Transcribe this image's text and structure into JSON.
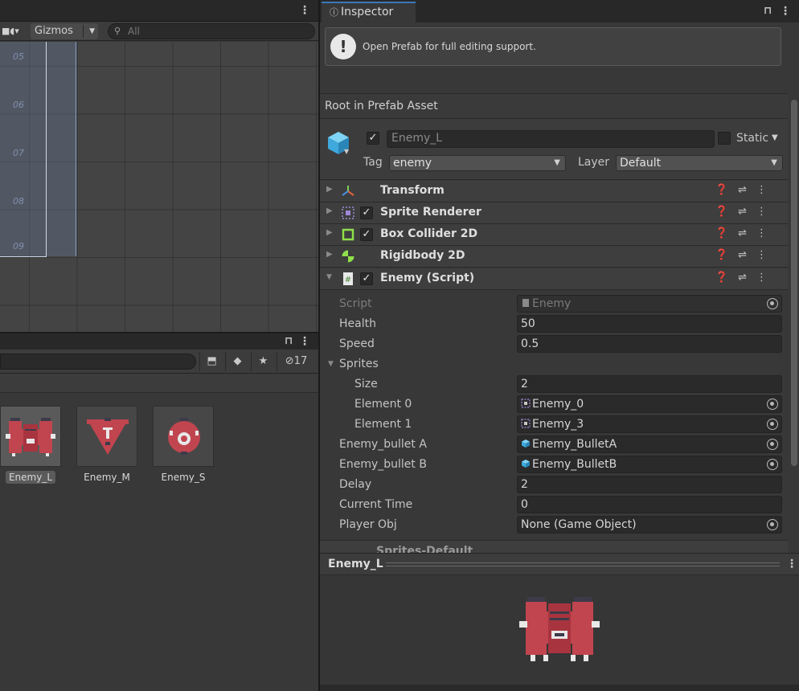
{
  "scene": {
    "gizmos_label": "Gizmos",
    "search_placeholder": "All",
    "row_labels": [
      "05",
      "06",
      "07",
      "08",
      "09"
    ]
  },
  "project": {
    "hidden_count": "17",
    "assets": [
      {
        "name": "Enemy_L",
        "selected": true
      },
      {
        "name": "Enemy_M",
        "selected": false
      },
      {
        "name": "Enemy_S",
        "selected": false
      }
    ]
  },
  "inspector": {
    "tab_label": "Inspector",
    "notice": "Open Prefab for full editing support.",
    "root_label": "Root in Prefab Asset",
    "object": {
      "active": true,
      "name": "Enemy_L",
      "static_label": "Static",
      "tag_label": "Tag",
      "tag_value": "enemy",
      "layer_label": "Layer",
      "layer_value": "Default"
    },
    "components": [
      {
        "name": "Transform",
        "has_checkbox": false,
        "expanded": false
      },
      {
        "name": "Sprite Renderer",
        "has_checkbox": true,
        "expanded": false
      },
      {
        "name": "Box Collider 2D",
        "has_checkbox": true,
        "expanded": false
      },
      {
        "name": "Rigidbody 2D",
        "has_checkbox": false,
        "expanded": false
      },
      {
        "name": "Enemy (Script)",
        "has_checkbox": true,
        "expanded": true
      }
    ],
    "script_props": {
      "script_label": "Script",
      "script_value": "Enemy",
      "health_label": "Health",
      "health_value": "50",
      "speed_label": "Speed",
      "speed_value": "0.5",
      "sprites_label": "Sprites",
      "size_label": "Size",
      "size_value": "2",
      "element0_label": "Element 0",
      "element0_value": "Enemy_0",
      "element1_label": "Element 1",
      "element1_value": "Enemy_3",
      "bulletA_label": "Enemy_bullet A",
      "bulletA_value": "Enemy_BulletA",
      "bulletB_label": "Enemy_bullet B",
      "bulletB_value": "Enemy_BulletB",
      "delay_label": "Delay",
      "delay_value": "2",
      "current_time_label": "Current Time",
      "current_time_value": "0",
      "player_obj_label": "Player Obj",
      "player_obj_value": "None (Game Object)"
    },
    "partial_row": "Sprites-Default"
  },
  "preview": {
    "title": "Enemy_L"
  },
  "colors": {
    "accent": "#3a79bb",
    "sprite_red": "#c0454f",
    "sprite_dark": "#3d3a4a"
  }
}
